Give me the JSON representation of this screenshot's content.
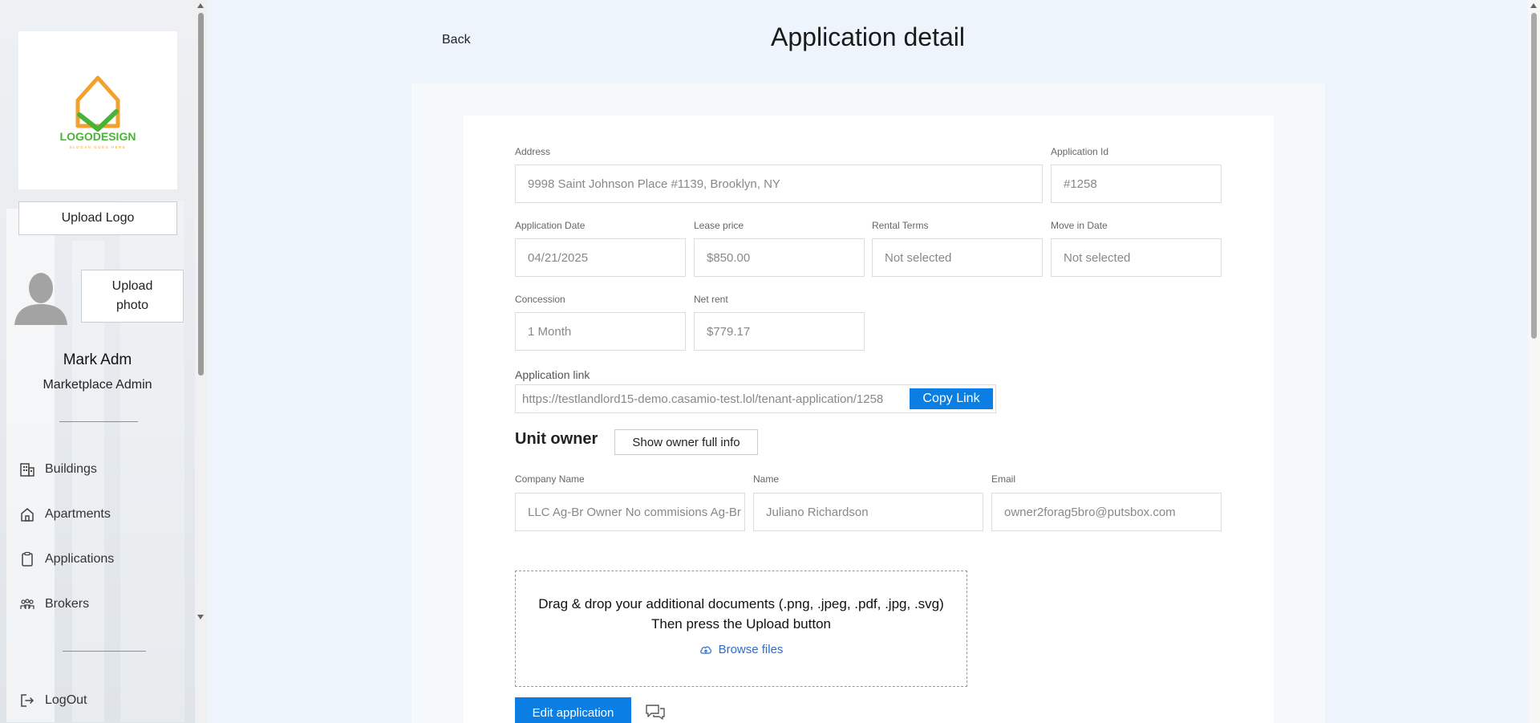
{
  "sidebar": {
    "logo": {
      "text": "LOGODESIGN",
      "tagline": "SLOGAN GOES HERE"
    },
    "upload_logo_label": "Upload Logo",
    "upload_photo_label": "Upload photo",
    "user_name": "Mark Adm",
    "user_role": "Marketplace Admin",
    "nav": [
      {
        "label": "Buildings",
        "icon": "building-icon"
      },
      {
        "label": "Apartments",
        "icon": "home-icon"
      },
      {
        "label": "Applications",
        "icon": "clipboard-icon"
      },
      {
        "label": "Brokers",
        "icon": "users-icon"
      }
    ],
    "logout_label": "LogOut"
  },
  "header": {
    "back_label": "Back",
    "title": "Application detail"
  },
  "form": {
    "address": {
      "label": "Address",
      "value": "9998 Saint Johnson Place #1139, Brooklyn, NY"
    },
    "application_id": {
      "label": "Application Id",
      "value": "#1258"
    },
    "application_date": {
      "label": "Application Date",
      "value": "04/21/2025"
    },
    "lease_price": {
      "label": "Lease price",
      "value": "$850.00"
    },
    "rental_terms": {
      "label": "Rental Terms",
      "value": "Not selected"
    },
    "move_in_date": {
      "label": "Move in Date",
      "value": "Not selected"
    },
    "concession": {
      "label": "Concession",
      "value": "1 Month"
    },
    "net_rent": {
      "label": "Net rent",
      "value": "$779.17"
    },
    "application_link": {
      "label": "Application link",
      "value": "https://testlandlord15-demo.casamio-test.lol/tenant-application/1258",
      "copy_label": "Copy Link"
    }
  },
  "owner": {
    "title": "Unit owner",
    "show_full_label": "Show owner full info",
    "company": {
      "label": "Company Name",
      "value": "LLC Ag-Br Owner No commisions Ag-Br"
    },
    "name": {
      "label": "Name",
      "value": "Juliano Richardson"
    },
    "email": {
      "label": "Email",
      "value": "owner2forag5bro@putsbox.com"
    }
  },
  "dropzone": {
    "line1": "Drag & drop your additional documents (.png, .jpeg, .pdf, .jpg, .svg)",
    "line2": "Then press the Upload button",
    "browse_label": "Browse files"
  },
  "actions": {
    "edit_label": "Edit application"
  },
  "colors": {
    "accent": "#0b7ee3",
    "link": "#2a6fd4",
    "background": "#edf4fc"
  }
}
